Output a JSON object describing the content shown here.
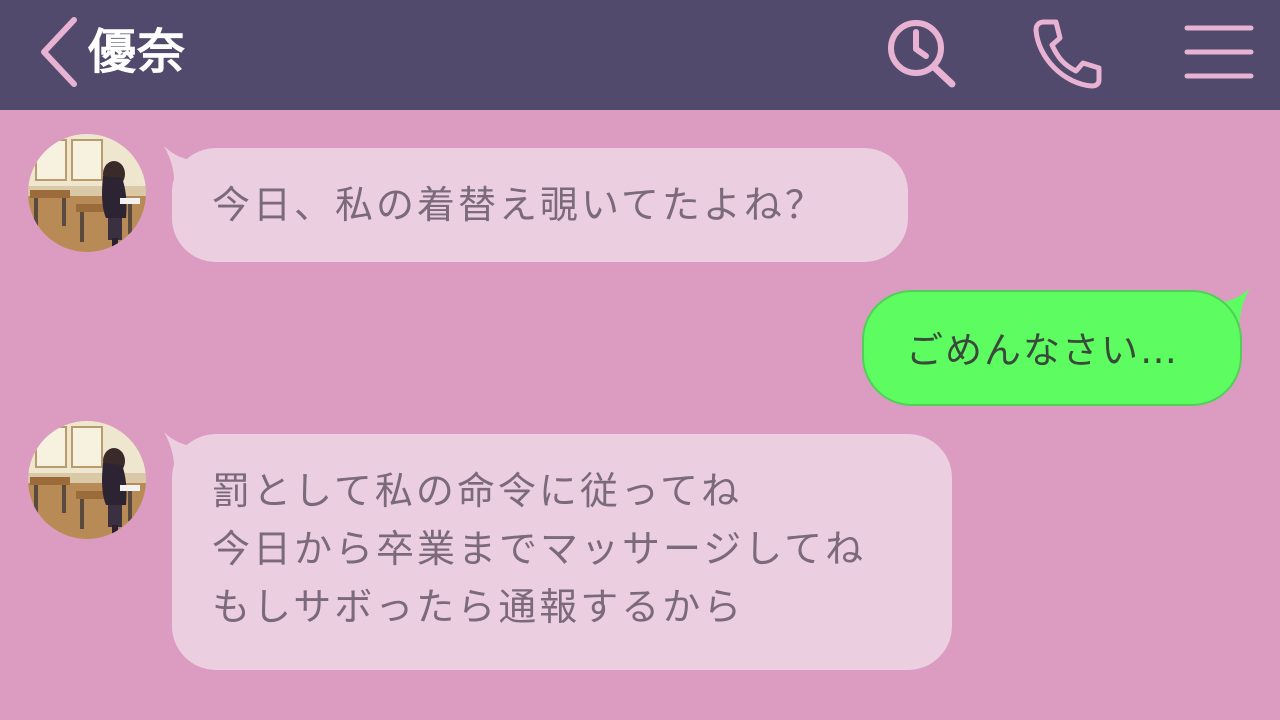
{
  "header": {
    "contact_name": "優奈",
    "back_icon": "chevron-left-icon",
    "search_icon": "search-history-icon",
    "call_icon": "phone-icon",
    "menu_icon": "hamburger-menu-icon"
  },
  "colors": {
    "header_bg": "#514a6c",
    "chat_bg": "#dc9bc1",
    "incoming_bubble": "#ebcfe1",
    "outgoing_bubble": "#5dfc61",
    "icon_stroke": "#e8b3d3"
  },
  "messages": [
    {
      "direction": "incoming",
      "avatar": "classroom-girl-avatar",
      "lines": [
        "今日、私の着替え覗いてたよね？"
      ]
    },
    {
      "direction": "outgoing",
      "lines": [
        "ごめんなさい…"
      ]
    },
    {
      "direction": "incoming",
      "avatar": "classroom-girl-avatar",
      "lines": [
        "罰として私の命令に従ってね",
        "今日から卒業までマッサージしてね",
        "もしサボったら通報するから"
      ]
    }
  ]
}
